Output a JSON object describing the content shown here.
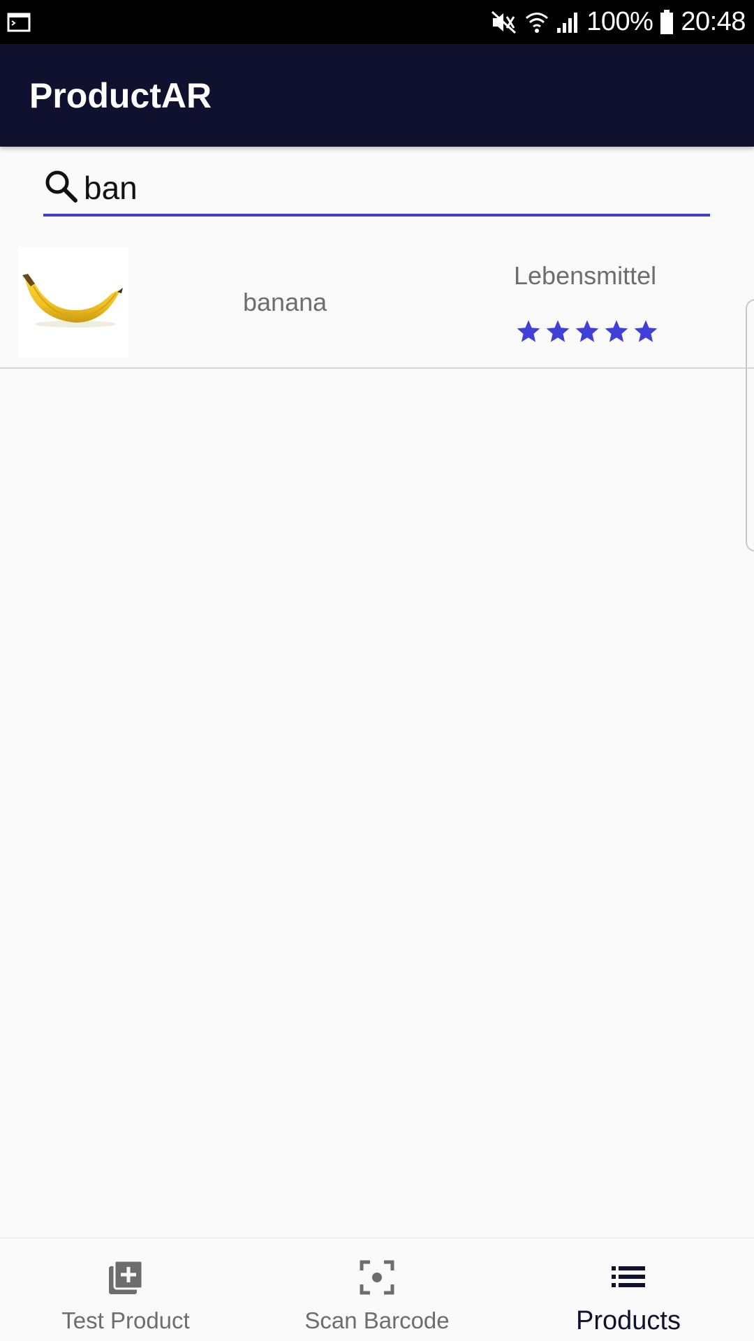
{
  "status_bar": {
    "battery_text": "100%",
    "time": "20:48",
    "icons": [
      "terminal-icon",
      "mute-icon",
      "wifi-icon",
      "signal-icon",
      "battery-icon"
    ]
  },
  "app_bar": {
    "title": "ProductAR"
  },
  "search": {
    "value": "ban",
    "icon": "search-icon",
    "accent_color": "#4040c8"
  },
  "products": [
    {
      "name": "banana",
      "category": "Lebensmittel",
      "rating": 5,
      "rating_max": 5,
      "image": "banana"
    }
  ],
  "bottom_nav": {
    "items": [
      {
        "label": "Test Product",
        "icon": "add-product-icon",
        "active": false
      },
      {
        "label": "Scan Barcode",
        "icon": "scan-barcode-icon",
        "active": false
      },
      {
        "label": "Products",
        "icon": "list-icon",
        "active": true
      }
    ]
  },
  "colors": {
    "app_bar": "#10112e",
    "star": "#4040d8",
    "text_secondary": "#6d6d6d"
  }
}
